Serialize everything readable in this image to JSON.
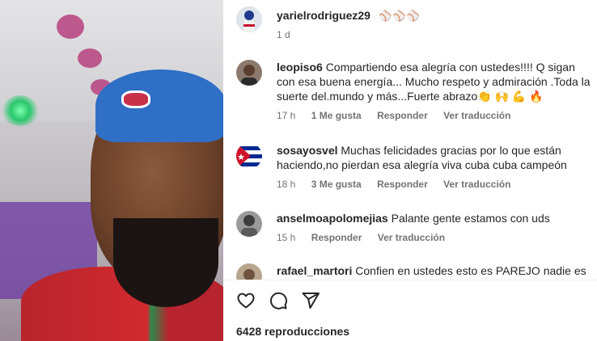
{
  "post": {
    "owner": "yarielrodriguez29",
    "owner_emoji": "⚾⚾⚾",
    "time": "1 d"
  },
  "comments": [
    {
      "user": "leopiso6",
      "text": "Compartiendo esa alegría con ustedes!!!! Q sigan con esa buena energía... Mucho respeto y admiración .Toda la suerte del.mundo y más...Fuerte abrazo👏 🙌 💪 🔥",
      "time": "17 h",
      "likes": "1 Me gusta",
      "reply": "Responder",
      "translate": "Ver traducción"
    },
    {
      "user": "sosayosvel",
      "text": "Muchas felicidades gracias por lo que están haciendo,no pierdan esa alegría viva cuba cuba campeón",
      "time": "18 h",
      "likes": "3 Me gusta",
      "reply": "Responder",
      "translate": "Ver traducción"
    },
    {
      "user": "anselmoapolomejias",
      "text": "Palante gente estamos con uds",
      "time": "15 h",
      "reply": "Responder",
      "translate": "Ver traducción"
    },
    {
      "user": "rafael_martori",
      "text": "Confien en ustedes esto es PAREJO nadie es"
    }
  ],
  "actions": {
    "like_icon": "heart-icon",
    "comment_icon": "comment-icon",
    "share_icon": "share-icon"
  },
  "views": "6428 reproducciones",
  "colors": {
    "text": "#262626",
    "muted": "#737373",
    "cap_blue": "#2f6fc5",
    "shirt_red": "#d12a2f"
  }
}
